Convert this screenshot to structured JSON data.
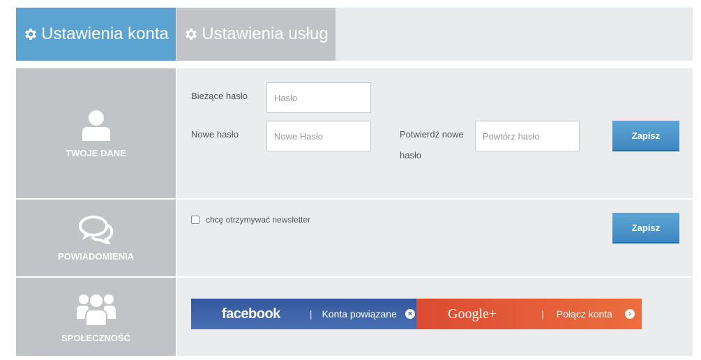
{
  "tabs": [
    {
      "label": "Ustawienia konta",
      "icon": "gear-icon",
      "active": true
    },
    {
      "label": "Ustawienia usług",
      "icon": "gear-icon",
      "active": false
    }
  ],
  "sections": {
    "profile": {
      "title": "TWOJE DANE",
      "icon": "user-icon",
      "current_password_label": "Bieżące hasło",
      "current_password_placeholder": "Hasło",
      "new_password_label": "Nowe hasło",
      "new_password_placeholder": "Nowe Hasło",
      "confirm_password_label_1": "Potwierdź nowe",
      "confirm_password_label_2": "hasło",
      "confirm_password_placeholder": "Powtórz hasło",
      "save_label": "Zapisz"
    },
    "notifications": {
      "title": "POWIADOMIENIA",
      "icon": "chat-bubbles-icon",
      "newsletter_label": "chcę otrzymywać newsletter",
      "save_label": "Zapisz"
    },
    "social": {
      "title": "SPOŁECZNOŚĆ",
      "icon": "group-icon",
      "facebook_brand": "facebook",
      "facebook_sep": "|",
      "facebook_text": "Konta powiązane",
      "facebook_action": "×",
      "google_brand": "Google+",
      "google_sep": "|",
      "google_text": "Połącz konta",
      "google_action": "›"
    }
  },
  "colors": {
    "accent": "#5ba3d0",
    "sidebar": "#c1c3c6",
    "panel": "#ebecee",
    "facebook": "#3b5998",
    "google": "#dd4b39"
  }
}
